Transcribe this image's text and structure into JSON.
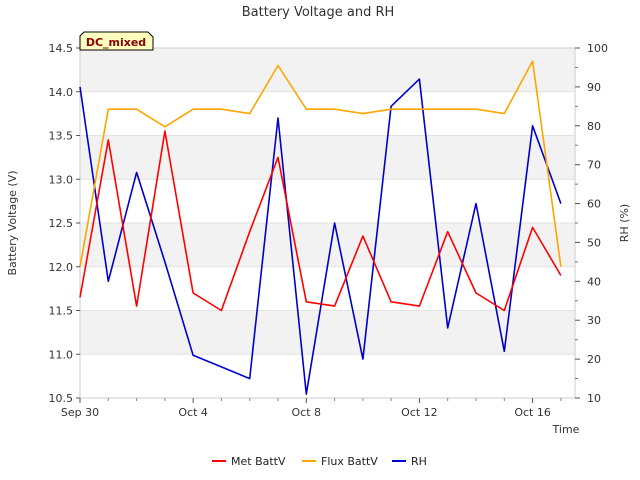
{
  "chart_data": {
    "type": "line",
    "title": "Battery Voltage and RH",
    "badge": "DC_mixed",
    "xlabel": "Time",
    "ylabel": "Battery Voltage (V)",
    "y2label": "RH (%)",
    "x_range": [
      "2022-09-30",
      "2022-10-17T12:00"
    ],
    "x_ticks": [
      "Sep 30",
      "Oct 4",
      "Oct 8",
      "Oct 12",
      "Oct 16"
    ],
    "ylim": [
      10.5,
      14.5
    ],
    "y_ticks": [
      "10.5",
      "11.0",
      "11.5",
      "12.0",
      "12.5",
      "13.0",
      "13.5",
      "14.0",
      "14.5"
    ],
    "y2lim": [
      10,
      100
    ],
    "y2_ticks": [
      "10",
      "20",
      "30",
      "40",
      "50",
      "60",
      "70",
      "80",
      "90",
      "100"
    ],
    "grid": true,
    "legend_position": "bottom",
    "series": [
      {
        "name": "Met BattV",
        "color": "#ff0000",
        "axis": "left",
        "x": [
          "Sep 30",
          "Oct 1",
          "Oct 2",
          "Oct 3",
          "Oct 4",
          "Oct 5",
          "Oct 6",
          "Oct 7",
          "Oct 8",
          "Oct 9",
          "Oct 10",
          "Oct 11",
          "Oct 12",
          "Oct 13",
          "Oct 14",
          "Oct 15",
          "Oct 16",
          "Oct 17"
        ],
        "values": [
          11.65,
          13.45,
          11.55,
          13.55,
          11.7,
          11.5,
          12.4,
          13.25,
          11.6,
          11.55,
          12.35,
          11.6,
          11.55,
          12.4,
          11.7,
          11.5,
          12.45,
          11.9
        ]
      },
      {
        "name": "Flux BattV",
        "color": "#ffa500",
        "axis": "left",
        "x": [
          "Sep 30",
          "Oct 1",
          "Oct 2",
          "Oct 3",
          "Oct 4",
          "Oct 5",
          "Oct 6",
          "Oct 7",
          "Oct 8",
          "Oct 9",
          "Oct 10",
          "Oct 11",
          "Oct 12",
          "Oct 13",
          "Oct 14",
          "Oct 15",
          "Oct 16",
          "Oct 17"
        ],
        "values": [
          12.0,
          13.8,
          13.8,
          13.6,
          13.8,
          13.8,
          13.75,
          14.3,
          13.8,
          13.8,
          13.75,
          13.8,
          13.8,
          13.8,
          13.8,
          13.75,
          14.35,
          12.0
        ]
      },
      {
        "name": "RH",
        "color": "#0000cc",
        "axis": "right",
        "x": [
          "Sep 30",
          "Oct 1",
          "Oct 2",
          "Oct 3",
          "Oct 4",
          "Oct 5",
          "Oct 6",
          "Oct 7",
          "Oct 8",
          "Oct 9",
          "Oct 10",
          "Oct 11",
          "Oct 12",
          "Oct 13",
          "Oct 14",
          "Oct 15",
          "Oct 16",
          "Oct 17"
        ],
        "values": [
          90,
          40,
          68,
          45,
          21,
          18,
          15,
          82,
          11,
          55,
          20,
          85,
          92,
          28,
          60,
          22,
          80,
          60
        ]
      }
    ]
  }
}
